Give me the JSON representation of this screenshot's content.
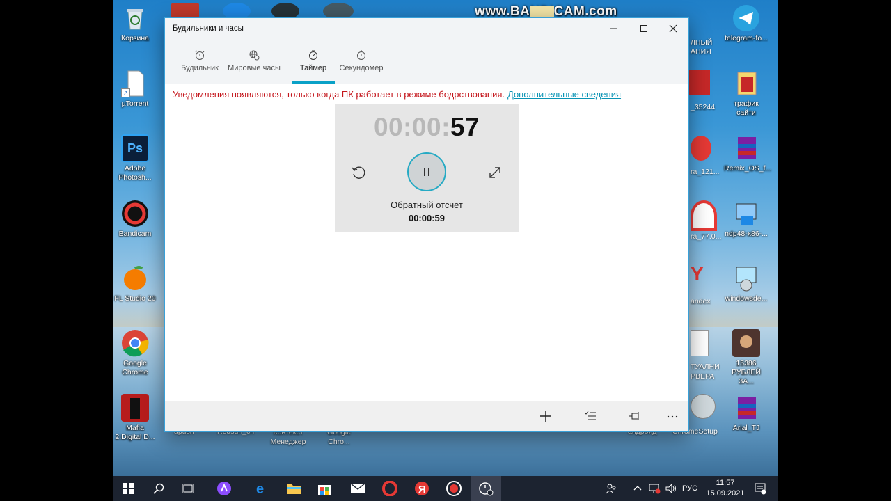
{
  "desktop": {
    "banner": "www.BANDICAM.com",
    "left_icons": [
      {
        "label": "Корзина",
        "icon": "recycle-bin-icon"
      },
      {
        "label": "µTorrent",
        "icon": "file-icon"
      },
      {
        "label": "Adobe Photosh...",
        "icon": "photoshop-icon"
      },
      {
        "label": "Bandicam",
        "icon": "bandicam-icon"
      },
      {
        "label": "FL Studio 20",
        "icon": "flstudio-icon"
      },
      {
        "label": "Google Chrome",
        "icon": "chrome-icon"
      },
      {
        "label": "Mafia 2.Digital D...",
        "icon": "mafia-icon"
      }
    ],
    "right_icons": [
      {
        "label": "telegram-fo...",
        "icon": "telegram-icon"
      },
      {
        "label": "трафик сайти",
        "icon": "winrar-icon"
      },
      {
        "label": "Remix_OS_f...",
        "icon": "winrar-icon"
      },
      {
        "label": "ndp48-x86-...",
        "icon": "installer-icon"
      },
      {
        "label": "windowsde...",
        "icon": "installer-icon"
      },
      {
        "label": "15386 РУБЛЕЙ ЗА...",
        "icon": "video-icon"
      },
      {
        "label": "Arial_TJ",
        "icon": "winrar-icon"
      }
    ],
    "partial_labels": {
      "p1": "ЛНЫЙ АНИЯ",
      "p2": "_35244",
      "p3": "ra_121...",
      "p4": "ra_77.0...",
      "p5": "andex",
      "p6": "ТУАЛНИ РВЕРА",
      "p7": "ChromeSetup",
      "p8": "андроид",
      "p9": "apush",
      "p10": "Redsun_ch",
      "p11": "Контекст Менеджер",
      "p12": "Google Chro..."
    }
  },
  "window": {
    "title": "Будильники и часы",
    "controls": {
      "minimize": "—",
      "maximize": "☐",
      "close": "✕"
    },
    "tabs": [
      {
        "label": "Будильник",
        "icon": "alarm-clock-icon"
      },
      {
        "label": "Мировые часы",
        "icon": "globe-icon"
      },
      {
        "label": "Таймер",
        "icon": "timer-icon",
        "active": true
      },
      {
        "label": "Секундомер",
        "icon": "stopwatch-icon"
      }
    ],
    "notice": "Уведомления появляются, только когда ПК работает в режиме бодрствования.",
    "notice_link": "Дополнительные сведения",
    "timer": {
      "time_dim": "00:00:",
      "time_seconds": "57",
      "label": "Обратный отсчет",
      "total": "00:00:59"
    },
    "command_bar": [
      "add-icon",
      "select-icon",
      "pin-icon",
      "more-icon"
    ]
  },
  "taskbar": {
    "apps": [
      "start-icon",
      "search-icon",
      "task-view-icon",
      "alice-icon",
      "edge-icon",
      "file-explorer-icon",
      "store-icon",
      "mail-icon",
      "opera-icon",
      "yandex-icon",
      "bandicam-icon",
      "alarms-icon"
    ],
    "language": "РУС",
    "time": "11:57",
    "date": "15.09.2021"
  }
}
